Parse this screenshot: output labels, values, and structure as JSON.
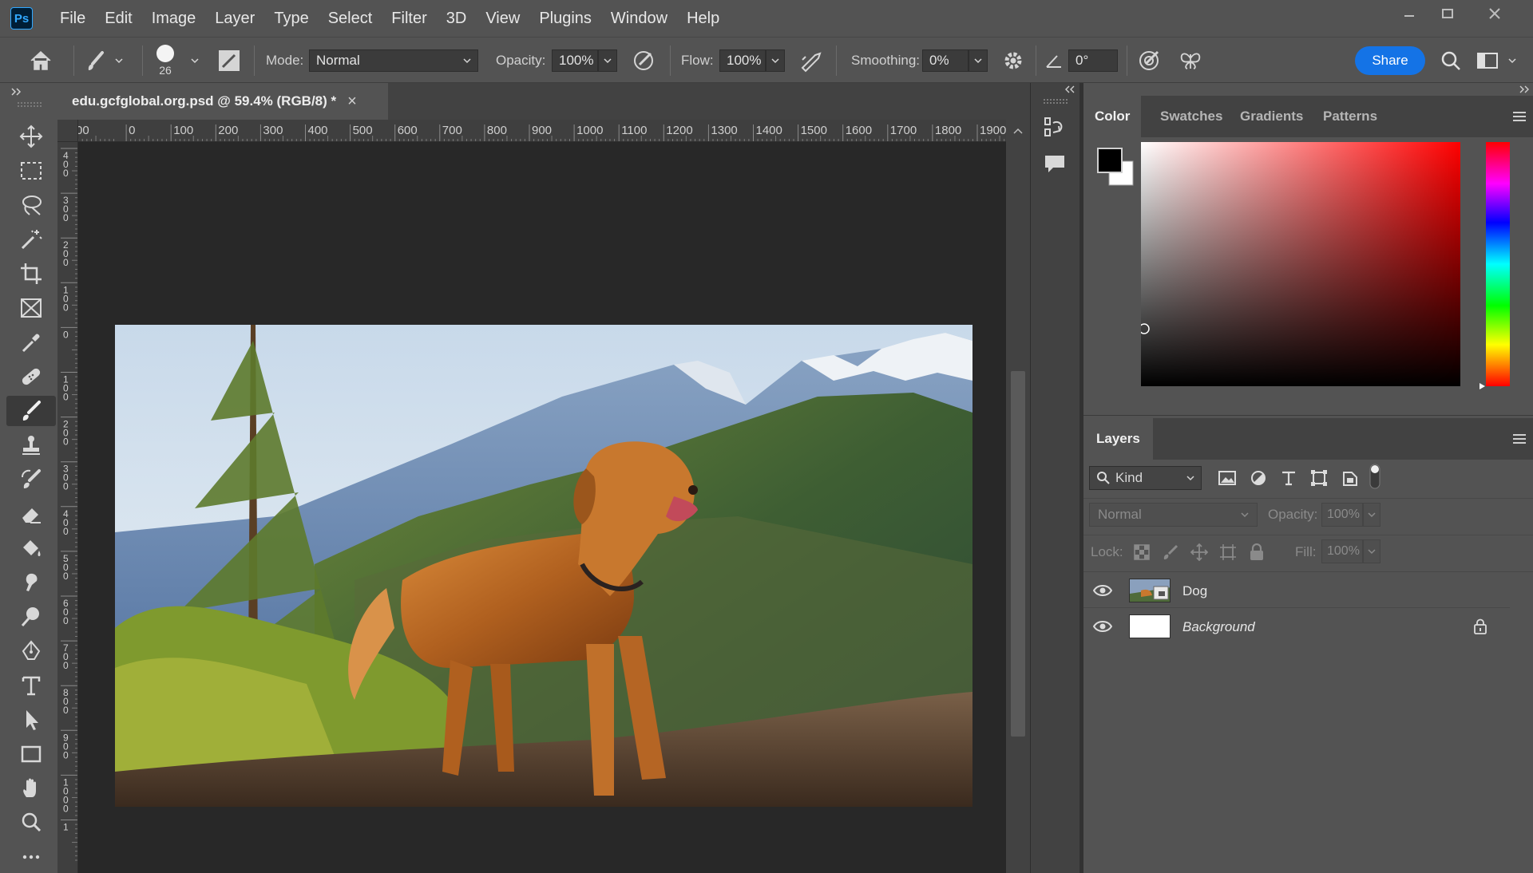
{
  "app": {
    "logo": "Ps",
    "menus": [
      "File",
      "Edit",
      "Image",
      "Layer",
      "Type",
      "Select",
      "Filter",
      "3D",
      "View",
      "Plugins",
      "Window",
      "Help"
    ]
  },
  "options_bar": {
    "brush_size": "26",
    "mode_label": "Mode:",
    "mode_value": "Normal",
    "opacity_label": "Opacity:",
    "opacity_value": "100%",
    "flow_label": "Flow:",
    "flow_value": "100%",
    "smoothing_label": "Smoothing:",
    "smoothing_value": "0%",
    "angle_value": "0°",
    "share_label": "Share"
  },
  "document": {
    "tab_title": "edu.gcfglobal.org.psd @ 59.4% (RGB/8) *",
    "close_glyph": "×",
    "ruler_h": [
      "00",
      "0",
      "100",
      "200",
      "300",
      "400",
      "500",
      "600",
      "700",
      "800",
      "900",
      "1000",
      "1100",
      "1200",
      "1300",
      "1400",
      "1500",
      "1600",
      "1700",
      "1800",
      "1900"
    ],
    "ruler_v": [
      "4 0 0",
      "3 0 0",
      "2 0 0",
      "1 0 0",
      "0",
      "1 0 0",
      "2 0 0",
      "3 0 0",
      "4 0 0",
      "5 0 0",
      "6 0 0",
      "7 0 0",
      "8 0 0",
      "9 0 0",
      "1 0 0 0",
      "1"
    ]
  },
  "color_panel": {
    "tabs": [
      "Color",
      "Swatches",
      "Gradients",
      "Patterns"
    ],
    "active_tab": "Color",
    "hue_color": "#ff0000",
    "foreground": "#000000",
    "background": "#ffffff"
  },
  "layers_panel": {
    "title": "Layers",
    "filter_label": "Kind",
    "blend_mode": "Normal",
    "opacity_label": "Opacity:",
    "opacity_value": "100%",
    "lock_label": "Lock:",
    "fill_label": "Fill:",
    "fill_value": "100%",
    "layers": [
      {
        "name": "Dog",
        "visible": true,
        "locked": false
      },
      {
        "name": "Background",
        "visible": true,
        "locked": true
      }
    ]
  },
  "colors": {
    "accent": "#1473e6",
    "panel": "#535353",
    "dark": "#424242",
    "canvas": "#282828"
  }
}
